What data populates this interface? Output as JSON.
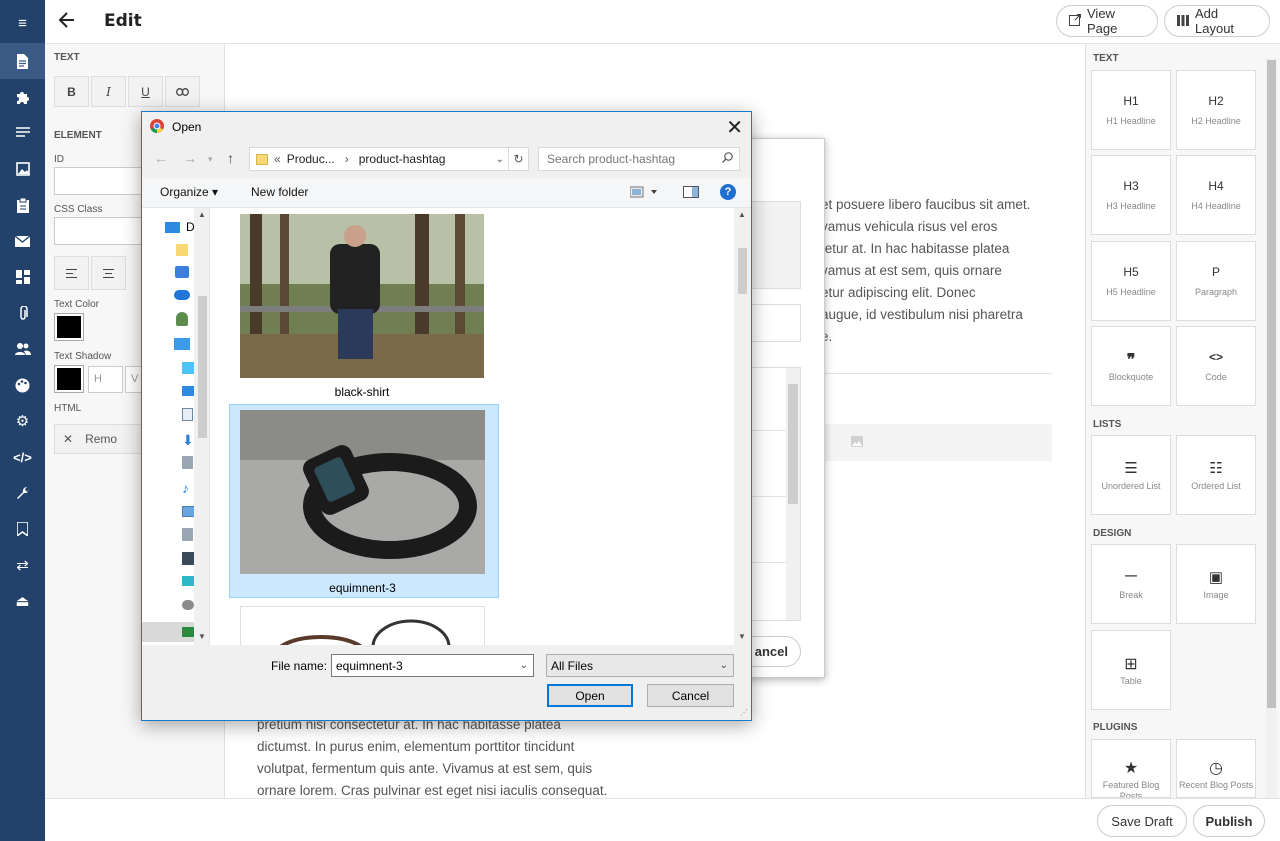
{
  "topbar": {
    "title": "Edit",
    "view_page": "View Page",
    "add_layout": "Add Layout"
  },
  "left_panel": {
    "text_section": "TEXT",
    "element_section": "ELEMENT",
    "id_label": "ID",
    "css_label": "CSS Class",
    "text_color_label": "Text Color",
    "text_shadow_label": "Text Shadow",
    "shadow_h": "H",
    "shadow_v": "V",
    "html_label": "HTML",
    "remove_label": "Remo",
    "text_color": "#000000"
  },
  "canvas": {
    "right_text": [
      "et posuere libero faucibus sit amet.",
      "vamus vehicula risus vel eros",
      "tetur at. In hac habitasse platea",
      "vamus at est sem, quis ornare",
      "etur adipiscing elit. Donec",
      "augue, id vestibulum nisi pharetra",
      "e."
    ],
    "bottom_text": [
      "pretium nisi consectetur at. In hac habitasse platea",
      "dictumst. In purus enim, elementum porttitor tincidunt",
      "volutpat, fermentum quis ante. Vivamus at est sem, quis",
      "ornare lorem. Cras pulvinar est eget nisi iaculis consequat."
    ],
    "modal_cancel": "ancel"
  },
  "right_panel": {
    "text_section": "TEXT",
    "lists_section": "LISTS",
    "design_section": "DESIGN",
    "plugins_section": "PLUGINS",
    "tiles": [
      {
        "main": "H1",
        "sub": "H1 Headline"
      },
      {
        "main": "H2",
        "sub": "H2 Headline"
      },
      {
        "main": "H3",
        "sub": "H3 Headline"
      },
      {
        "main": "H4",
        "sub": "H4 Headline"
      },
      {
        "main": "H5",
        "sub": "H5 Headline"
      },
      {
        "main": "P",
        "sub": "Paragraph"
      },
      {
        "main": "❞",
        "sub": "Blockquote"
      },
      {
        "main": "<>",
        "sub": "Code"
      },
      {
        "main": "☰",
        "sub": "Unordered List"
      },
      {
        "main": "☷",
        "sub": "Ordered List"
      },
      {
        "main": "—",
        "sub": "Break"
      },
      {
        "main": "▣",
        "sub": "Image"
      },
      {
        "main": "⊞",
        "sub": "Table"
      },
      {
        "main": "★",
        "sub": "Featured Blog Posts"
      },
      {
        "main": "◷",
        "sub": "Recent Blog Posts"
      }
    ]
  },
  "bottombar": {
    "save_draft": "Save Draft",
    "publish": "Publish"
  },
  "dialog": {
    "title": "Open",
    "path_prefix": "«",
    "path_parent": "Produc...",
    "path_current": "product-hashtag",
    "search_placeholder": "Search product-hashtag",
    "organize": "Organize",
    "new_folder": "New folder",
    "tree_top_label": "D",
    "files": [
      {
        "name": "black-shirt"
      },
      {
        "name": "equimnent-3"
      }
    ],
    "filename_label": "File name:",
    "filename_value": "equimnent-3",
    "filetype_value": "All Files",
    "open_button": "Open",
    "cancel_button": "Cancel"
  }
}
